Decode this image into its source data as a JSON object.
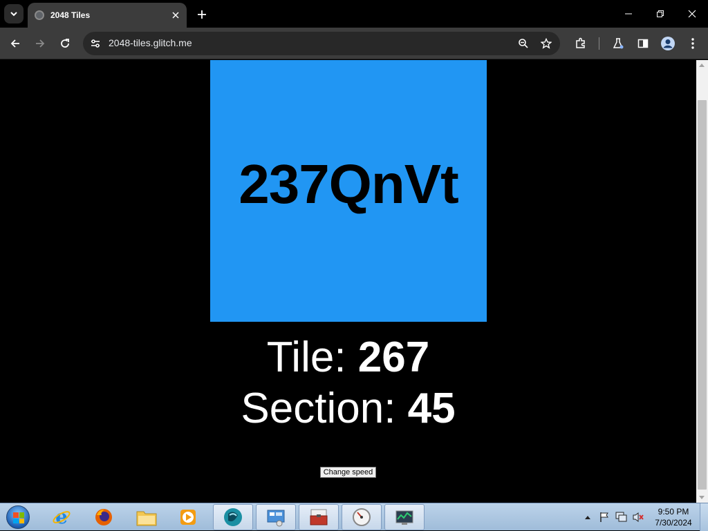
{
  "browser": {
    "tab_title": "2048 Tiles",
    "url": "2048-tiles.glitch.me"
  },
  "page": {
    "tile_text": "237QnVt",
    "tile_color": "#2196f3",
    "tile_label": "Tile: ",
    "tile_number": "267",
    "section_label": "Section: ",
    "section_number": "45",
    "speed_button": "Change speed"
  },
  "taskbar": {
    "apps": [
      "internet-explorer-icon",
      "firefox-icon",
      "file-explorer-icon",
      "media-player-icon",
      "app-icon",
      "control-panel-icon",
      "toolbox-icon",
      "speedometer-icon",
      "network-monitor-icon"
    ],
    "clock_time": "9:50 PM",
    "clock_date": "7/30/2024"
  }
}
